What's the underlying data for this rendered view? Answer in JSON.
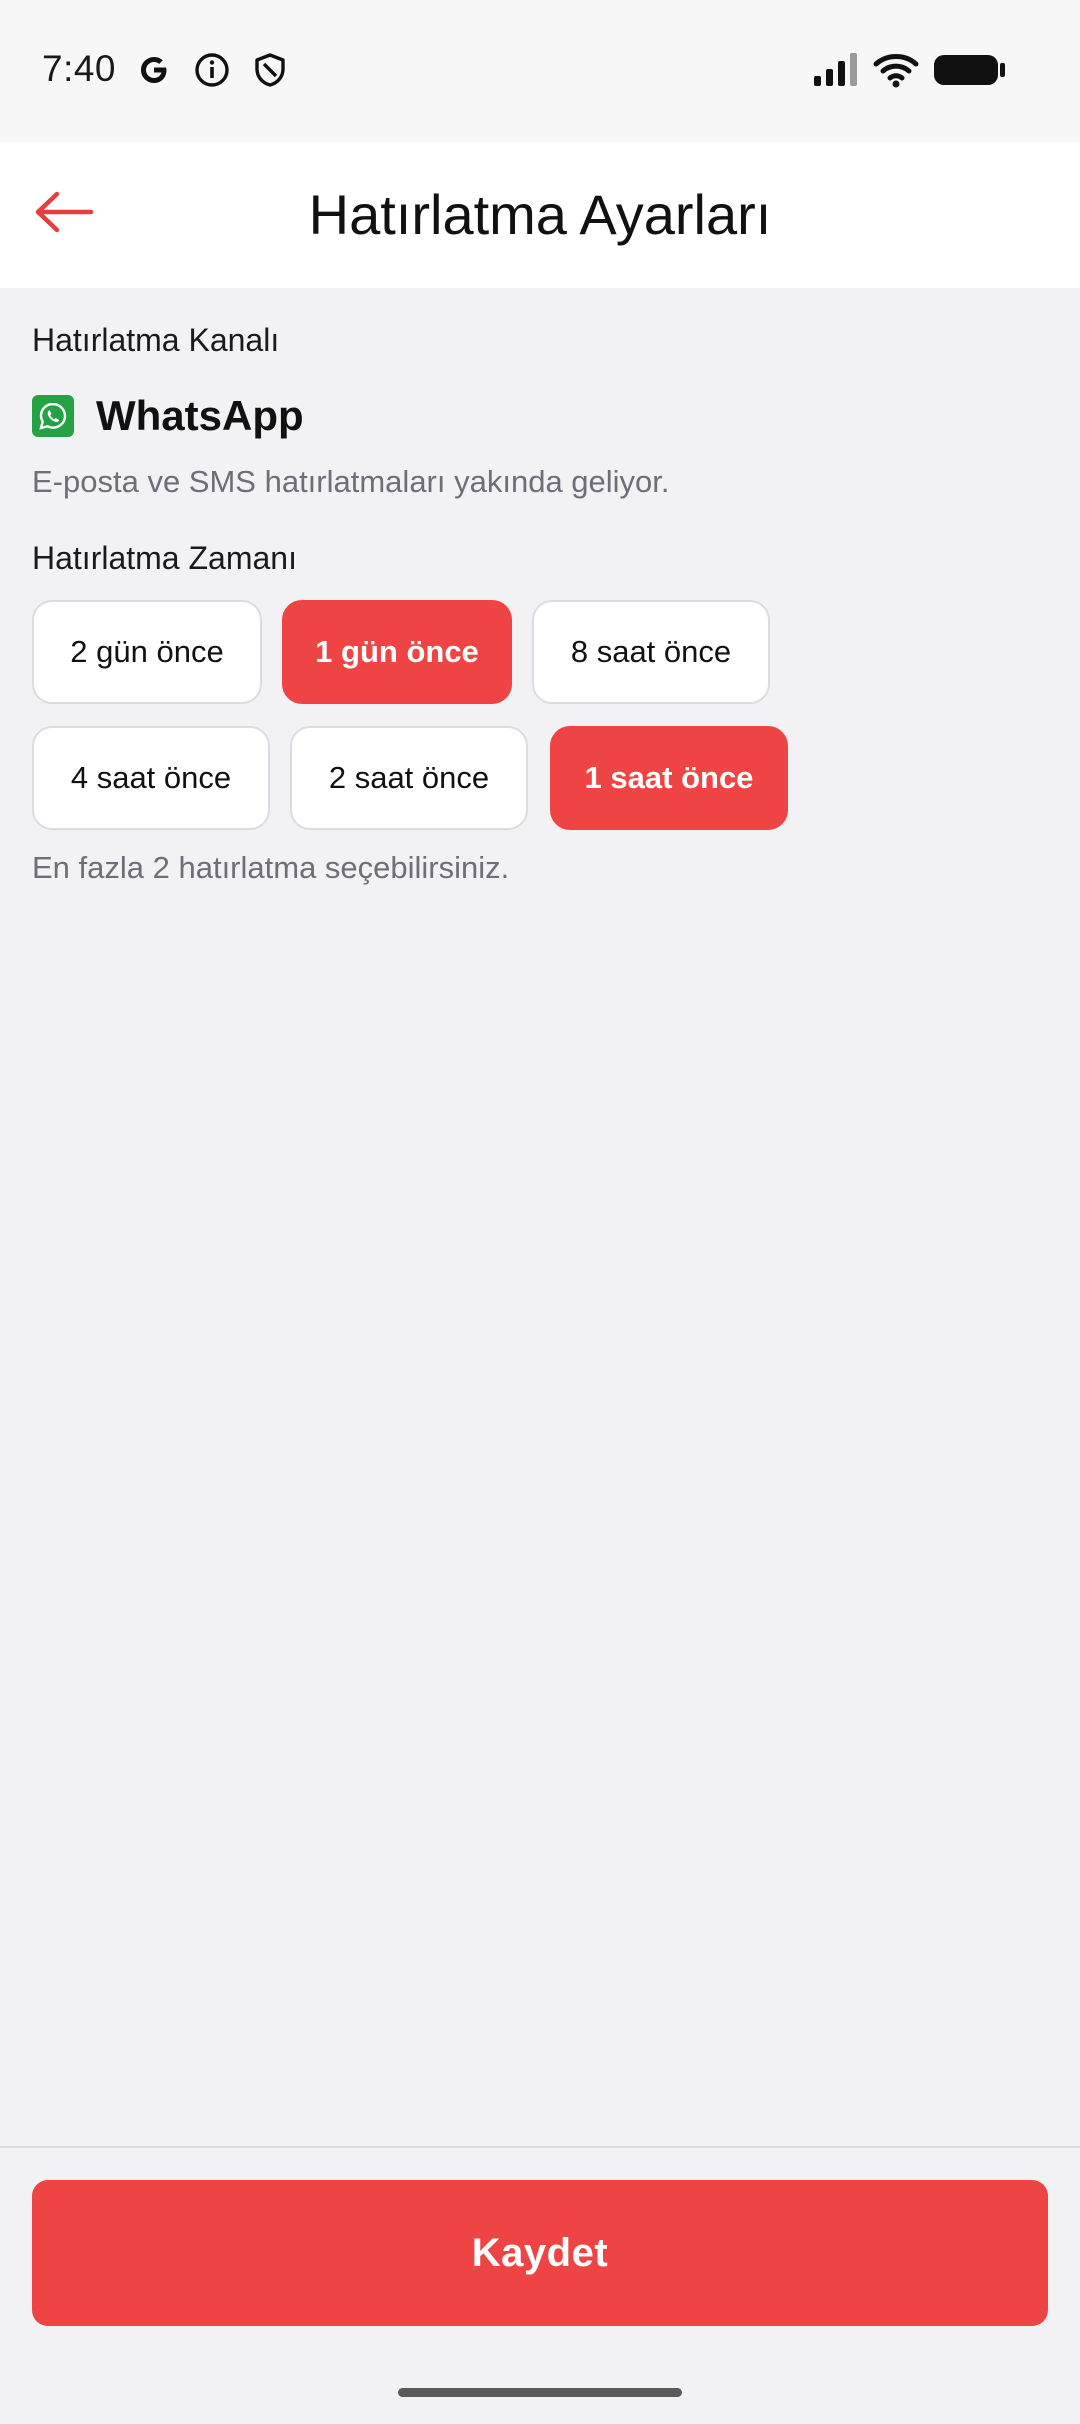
{
  "status_bar": {
    "time": "7:40",
    "icons": [
      "google-icon",
      "info-icon",
      "shield-icon",
      "signal-icon",
      "wifi-icon",
      "battery-icon"
    ]
  },
  "header": {
    "title": "Hatırlatma Ayarları",
    "back_icon": "arrow-left-icon"
  },
  "channel_section": {
    "label": "Hatırlatma Kanalı",
    "channel_name": "WhatsApp",
    "channel_icon": "whatsapp-icon",
    "hint": "E-posta ve SMS hatırlatmaları yakında geliyor."
  },
  "time_section": {
    "label": "Hatırlatma Zamanı",
    "options": [
      {
        "label": "2 gün önce",
        "selected": false
      },
      {
        "label": "1 gün önce",
        "selected": true
      },
      {
        "label": "8 saat önce",
        "selected": false
      },
      {
        "label": "4 saat önce",
        "selected": false
      },
      {
        "label": "2 saat önce",
        "selected": false
      },
      {
        "label": "1 saat önce",
        "selected": true
      }
    ],
    "hint": "En fazla 2 hatırlatma seçebilirsiniz."
  },
  "footer": {
    "save_label": "Kaydet"
  },
  "colors": {
    "accent": "#ef4444",
    "whatsapp": "#25a244",
    "background": "#f2f2f5"
  }
}
